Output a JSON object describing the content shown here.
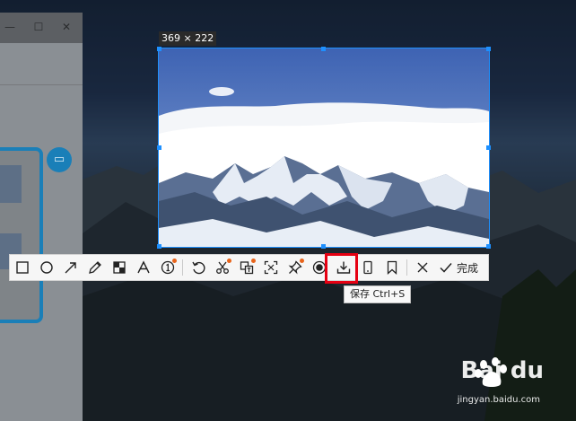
{
  "selection": {
    "size_label": "369 × 222"
  },
  "app_window": {
    "minimize_icon": "minimize-icon",
    "maximize_icon": "maximize-icon",
    "close_icon": "close-icon",
    "minimize_glyph": "—",
    "maximize_glyph": "☐",
    "close_glyph": "✕"
  },
  "toolbar": {
    "tools": [
      {
        "icon": "rectangle-icon"
      },
      {
        "icon": "ellipse-icon"
      },
      {
        "icon": "arrow-icon"
      },
      {
        "icon": "pencil-icon"
      },
      {
        "icon": "mosaic-icon"
      },
      {
        "icon": "text-icon"
      },
      {
        "icon": "number-marker-icon"
      },
      {
        "icon": "undo-icon"
      },
      {
        "icon": "scissors-icon"
      },
      {
        "icon": "translate-icon"
      },
      {
        "icon": "ocr-icon"
      },
      {
        "icon": "pin-icon"
      },
      {
        "icon": "record-icon"
      },
      {
        "icon": "download-icon"
      },
      {
        "icon": "phone-icon"
      },
      {
        "icon": "bookmark-icon"
      },
      {
        "icon": "close-icon"
      },
      {
        "icon": "check-icon"
      }
    ],
    "done_label": "完成",
    "save_tooltip": "保存 Ctrl+S"
  },
  "watermark": {
    "brand": "Bai du",
    "url": "jingyan.baidu.com"
  },
  "colors": {
    "accent": "#1e90ff",
    "highlight": "#e60012",
    "badge_dot": "#e8641b",
    "app_accent": "#1a7fb8"
  }
}
